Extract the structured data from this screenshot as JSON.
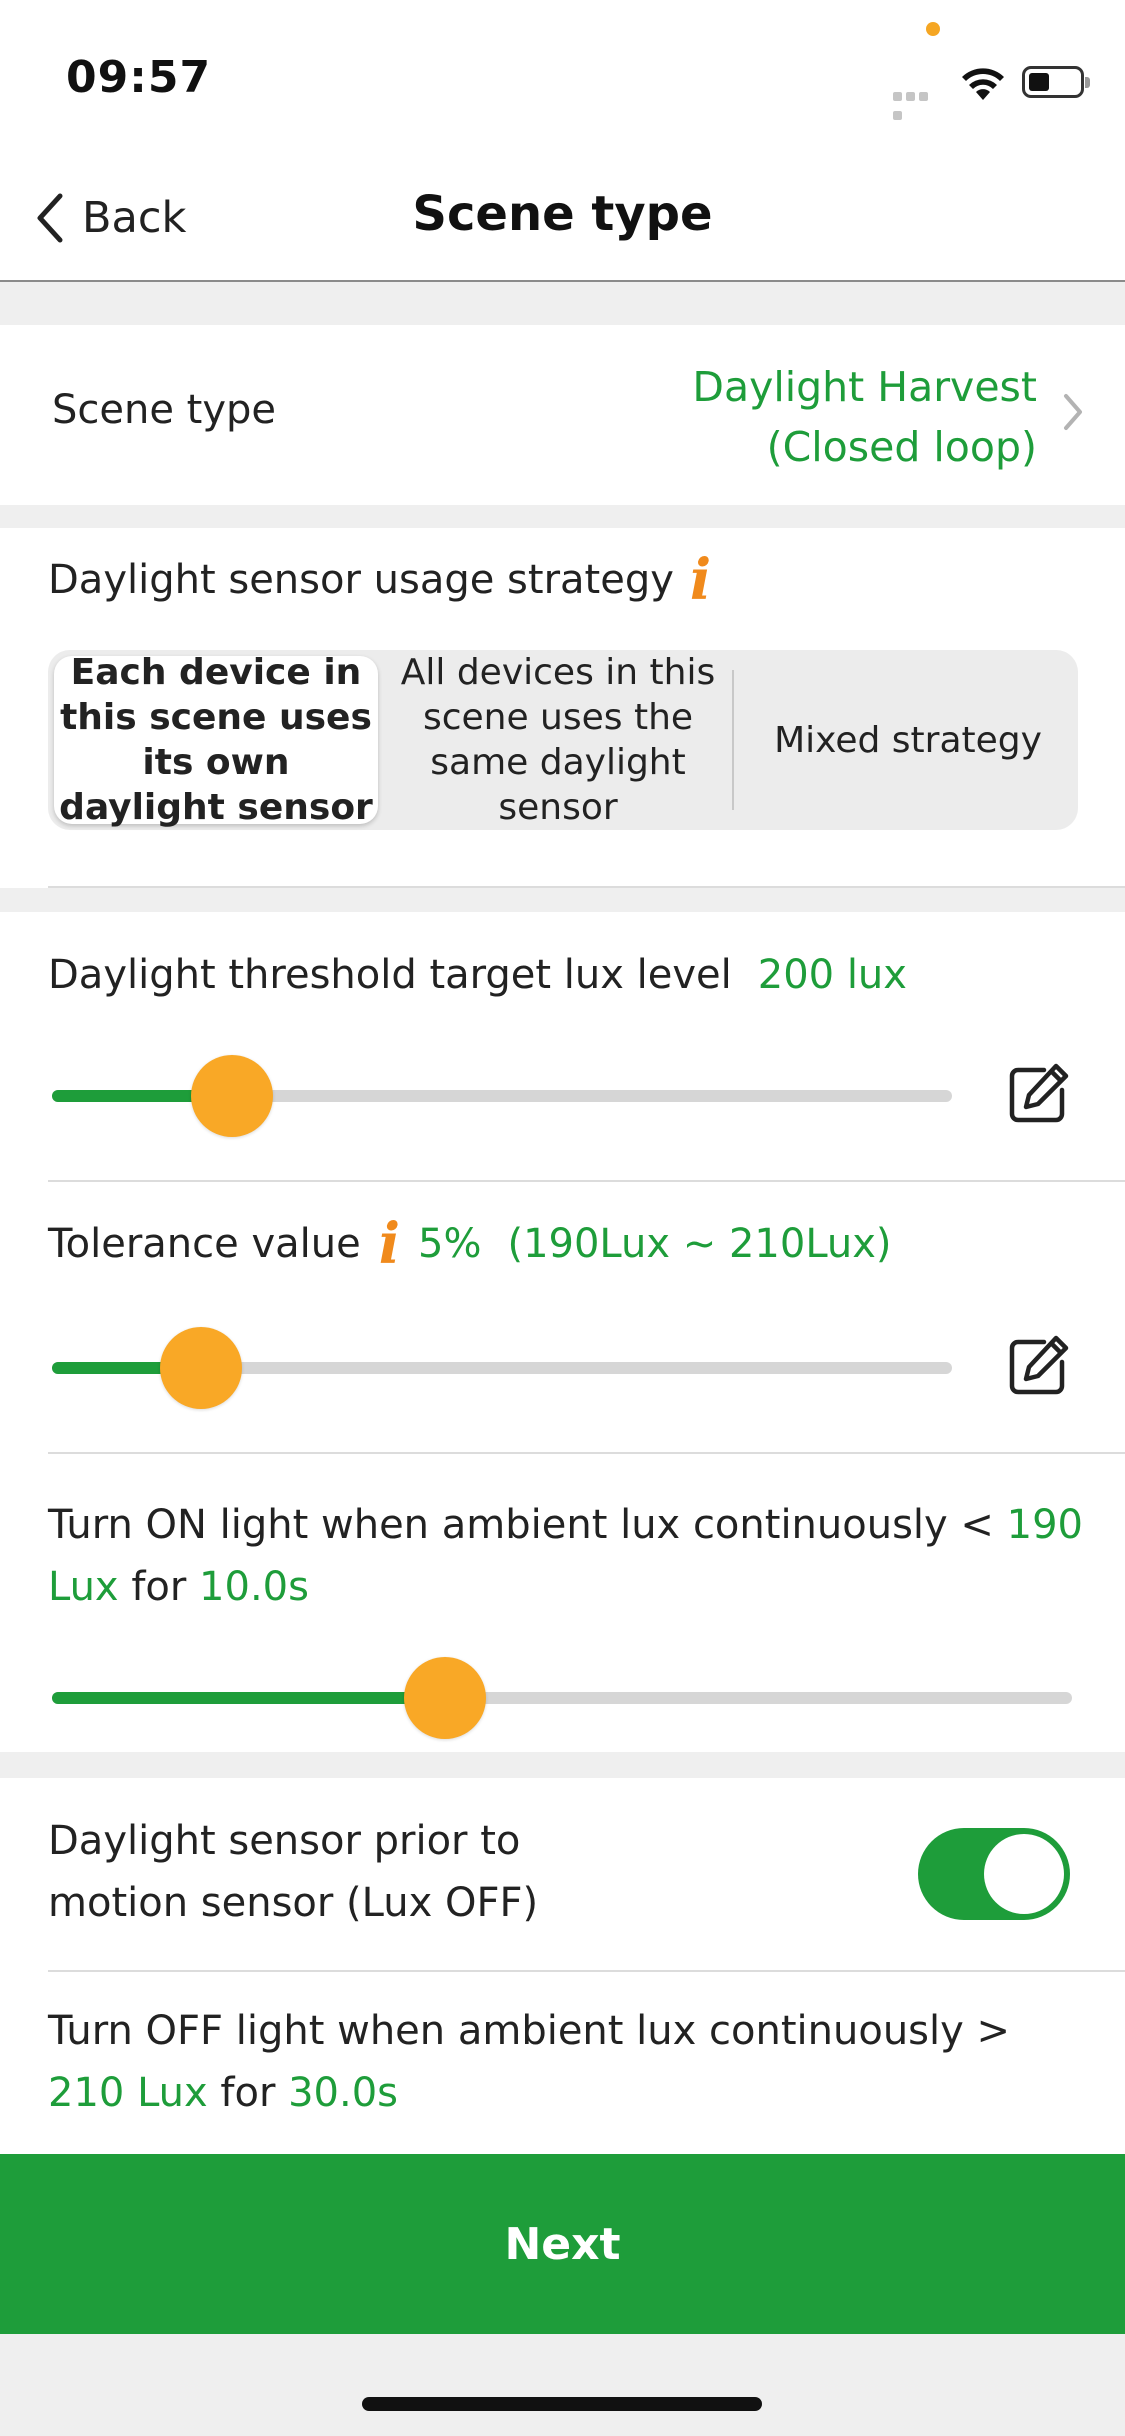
{
  "status": {
    "time": "09:57"
  },
  "nav": {
    "back_label": "Back",
    "title": "Scene type"
  },
  "scene_type": {
    "label": "Scene type",
    "value_line1": "Daylight Harvest",
    "value_line2": "(Closed loop)"
  },
  "strategy": {
    "label": "Daylight sensor usage strategy",
    "options": [
      {
        "label": "Each device in this scene uses its own daylight sensor",
        "selected": true
      },
      {
        "label": "All devices in this scene uses the same daylight sensor",
        "selected": false
      },
      {
        "label": "Mixed strategy",
        "selected": false
      }
    ]
  },
  "threshold": {
    "label": "Daylight threshold target lux level",
    "value": "200 lux",
    "slider_fraction": 0.2
  },
  "tolerance": {
    "label": "Tolerance value",
    "value": "5%",
    "range": "(190Lux ~ 210Lux)",
    "slider_fraction": 0.165
  },
  "turn_on": {
    "prefix": "Turn ON light when ambient lux continuously < ",
    "lux_line1": "190",
    "lux_line2": "Lux",
    "for": " for ",
    "duration": "10.0s",
    "slider_fraction": 0.385
  },
  "prior": {
    "label_line1": "Daylight sensor prior to",
    "label_line2": "motion sensor (Lux OFF)",
    "enabled": true
  },
  "turn_off": {
    "prefix": "Turn OFF light when ambient lux continuously >",
    "lux": "210 Lux",
    "for": " for ",
    "duration": "30.0s"
  },
  "footer": {
    "next_label": "Next"
  },
  "colors": {
    "accent": "#1e9d3a",
    "knob": "#f9a826",
    "info": "#f08a1c"
  }
}
